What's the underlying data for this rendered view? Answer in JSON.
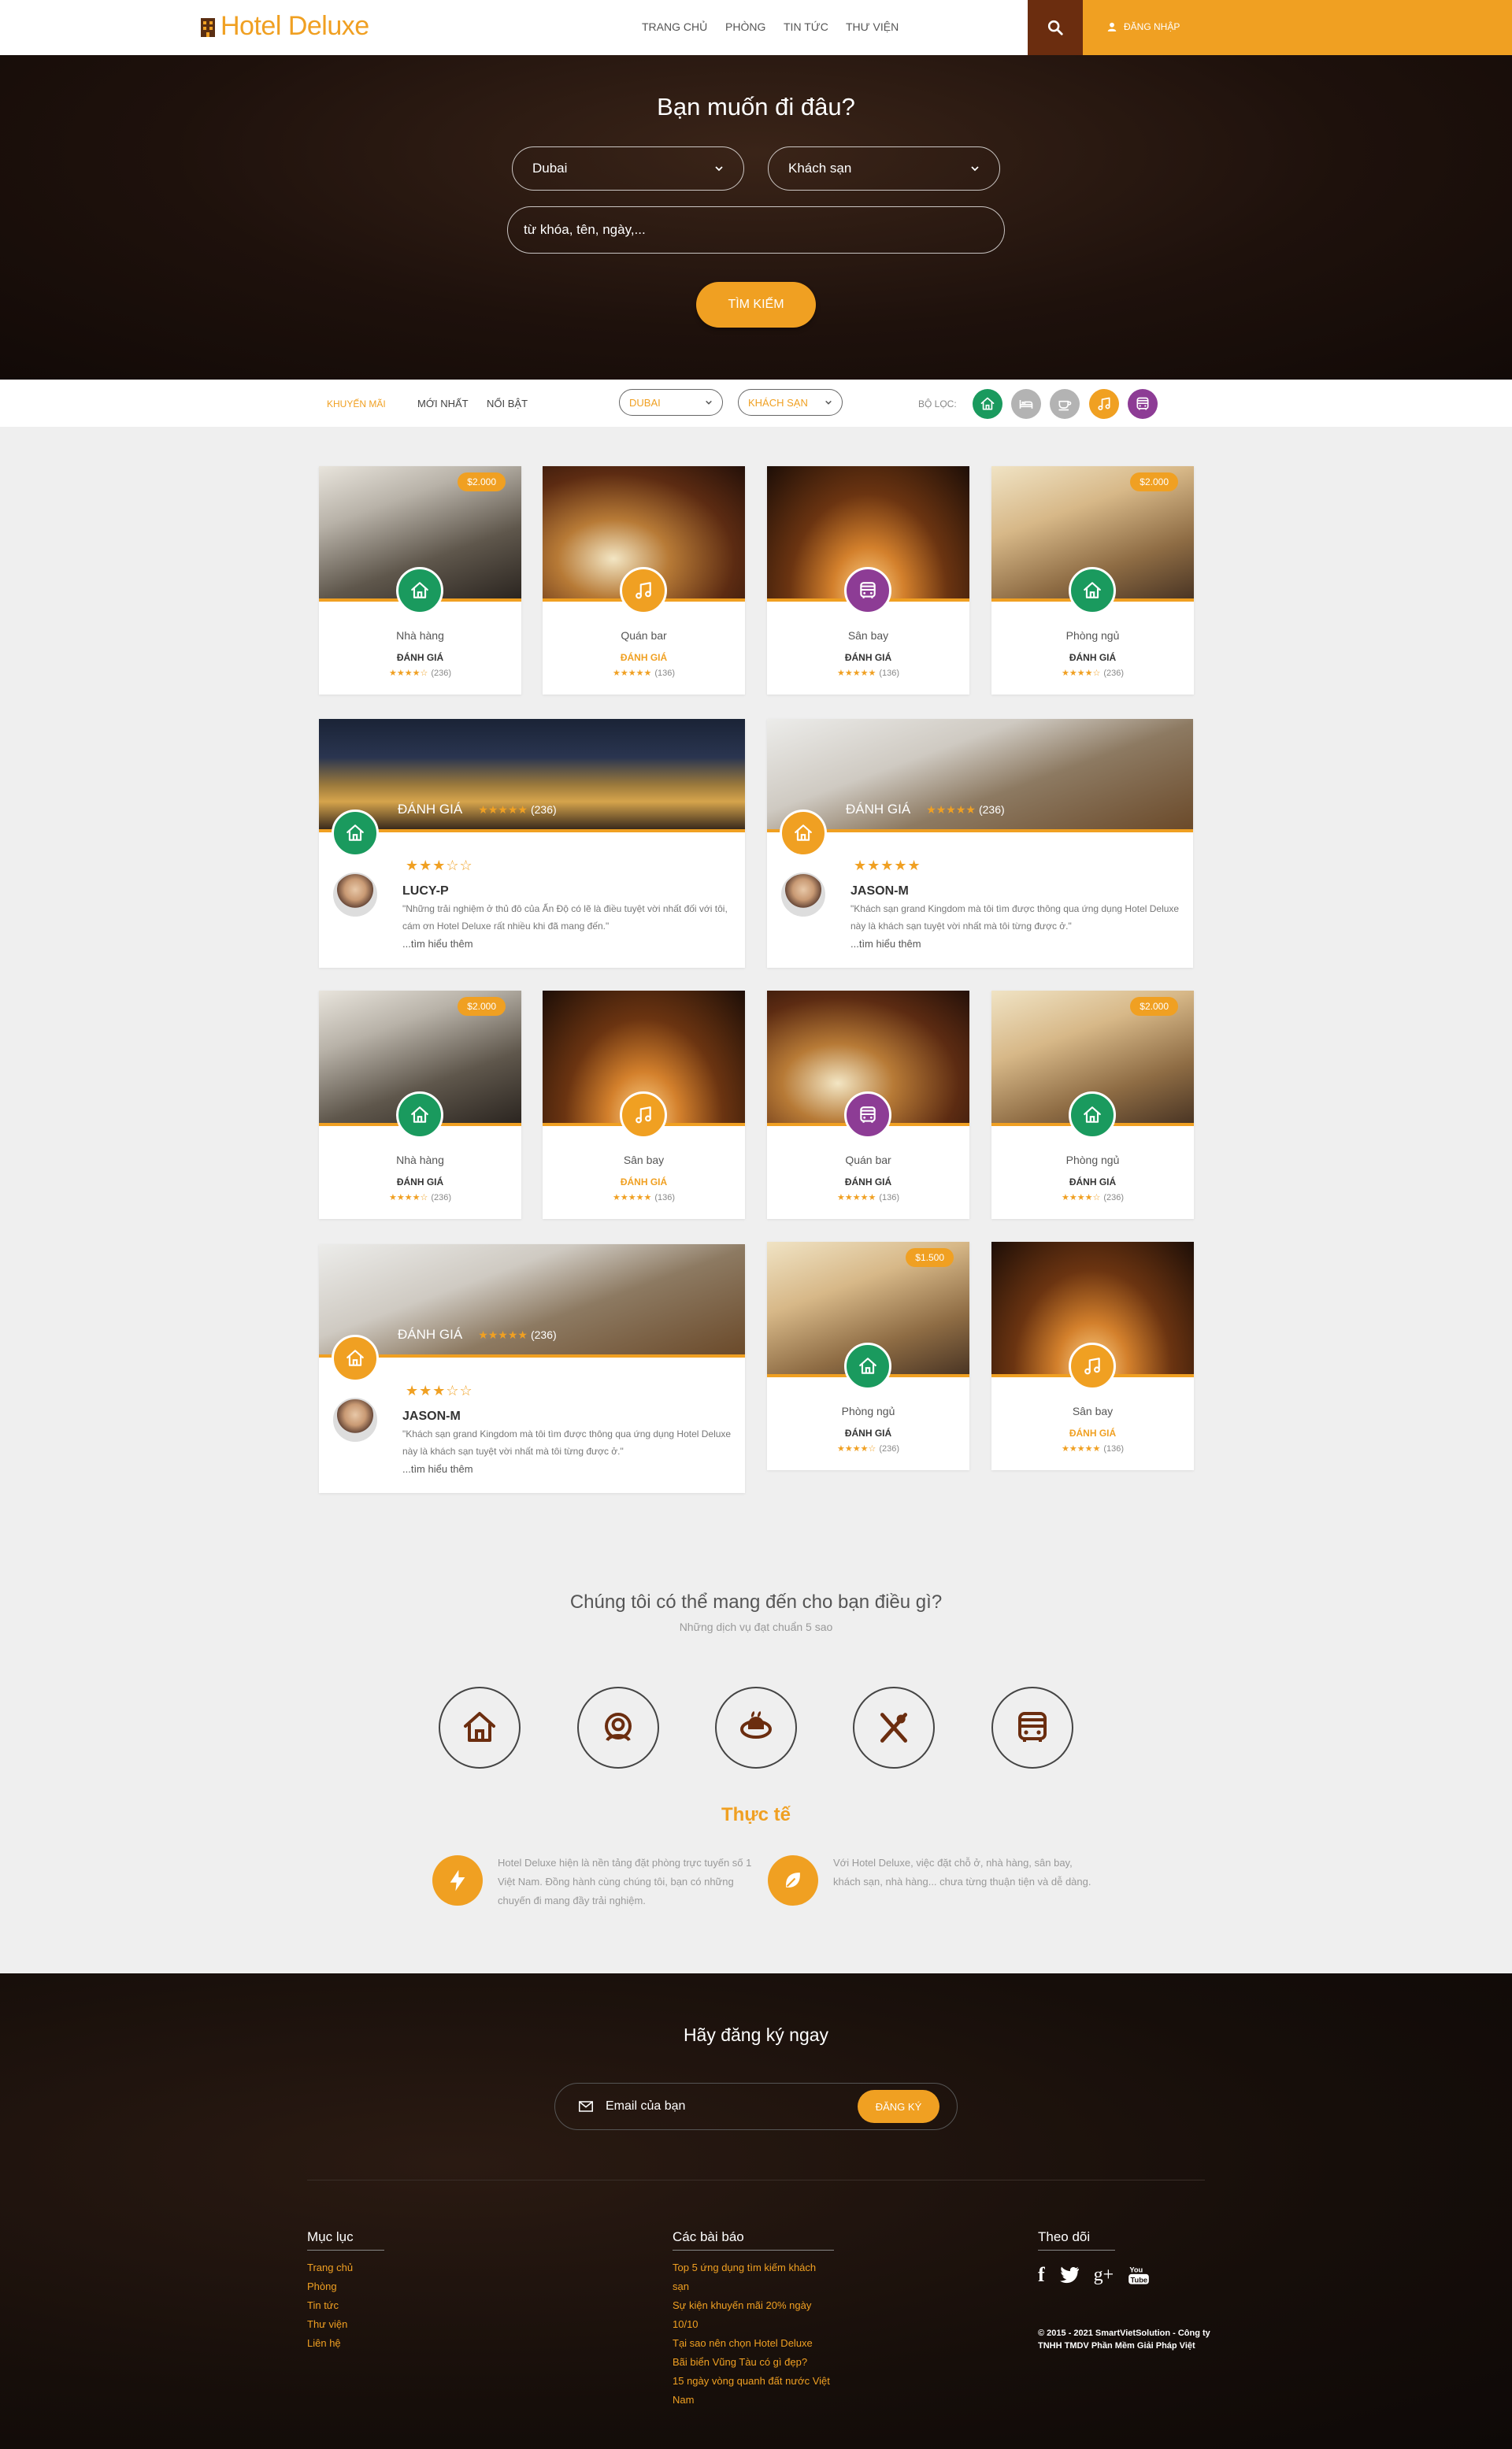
{
  "header": {
    "brand": "Hotel Deluxe",
    "nav": [
      "TRANG CHỦ",
      "PHÒNG",
      "TIN TỨC",
      "THƯ VIỆN"
    ],
    "login_label": "Đăng nhập"
  },
  "hero": {
    "title": "Bạn muốn đi đâu?",
    "location_select": "Dubai",
    "type_select": "Khách sạn",
    "keyword_placeholder": "từ khóa, tên, ngày,...",
    "search_button": "TÌM KIẾM"
  },
  "filter_bar": {
    "tabs": [
      "KHUYẾN MÃI",
      "MỚI NHẤT",
      "NỔI BẬT"
    ],
    "location_select": "DUBAI",
    "type_select": "KHÁCH SẠN",
    "filter_label": "BỘ LỌC:"
  },
  "rating_label": "ĐÁNH GIÁ",
  "cards": [
    {
      "name": "Nhà hàng",
      "price": "$2.000",
      "icon": "home-icon",
      "count": "(236)",
      "rating": 3.5
    },
    {
      "name": "Quán bar",
      "icon": "music-icon",
      "count": "(136)",
      "rating": 5
    },
    {
      "name": "Sân bay",
      "icon": "bus-icon",
      "count": "(136)",
      "rating": 5
    },
    {
      "name": "Phòng ngủ",
      "price": "$2.000",
      "icon": "home-icon",
      "count": "(236)",
      "rating": 4
    },
    {
      "name": "Nhà hàng",
      "price": "$2.000",
      "icon": "home-icon",
      "count": "(236)",
      "rating": 4
    },
    {
      "name": "Sân bay",
      "icon": "music-icon",
      "count": "(136)",
      "rating": 5
    },
    {
      "name": "Quán bar",
      "icon": "bus-icon",
      "count": "(136)",
      "rating": 5
    },
    {
      "name": "Phòng ngủ",
      "price": "$2.000",
      "icon": "home-icon",
      "count": "(236)",
      "rating": 4
    },
    {
      "name": "Phòng ngủ",
      "price": "$1.500",
      "icon": "home-icon",
      "count": "(236)",
      "rating": 3.5
    },
    {
      "name": "Sân bay",
      "icon": "music-icon",
      "count": "(136)",
      "rating": 5
    }
  ],
  "reviews": [
    {
      "user": "LUCY-P",
      "count": "(236)",
      "rating": 3,
      "text": "\"Những trải nghiệm ở thủ đô của Ấn Độ có lẽ là điều tuyệt vời nhất đối với tôi, cám ơn Hotel Deluxe rất nhiều khi đã mang đến.\"",
      "more": "...tìm hiểu thêm"
    },
    {
      "user": "JASON-M",
      "count": "(236)",
      "rating": 5,
      "text": "\"Khách sạn grand Kingdom mà tôi tìm được thông qua ứng dụng Hotel Deluxe này là khách sạn tuyệt vời nhất mà tôi từng được ở.\"",
      "more": "...tìm hiểu thêm"
    },
    {
      "user": "JASON-M",
      "count": "(236)",
      "rating": 3,
      "text": "\"Khách sạn grand Kingdom mà tôi tìm được thông qua ứng dụng Hotel Deluxe này là khách sạn tuyệt vời nhất mà tôi từng được ở.\"",
      "more": "...tìm hiểu thêm"
    }
  ],
  "services": {
    "title": "Chúng tôi có thể mang đến cho bạn điều gì?",
    "subtitle": "Những dịch vụ đạt chuẩn 5 sao",
    "icons": [
      "home-icon",
      "receptionist-icon",
      "coffee-icon",
      "restaurant-icon",
      "bus-icon"
    ],
    "fact_title": "Thực tế",
    "facts": [
      {
        "icon": "lightning-icon",
        "text": "Hotel Deluxe hiện là nền tảng đặt phòng trực tuyến số 1 Việt Nam. Đồng hành cùng chúng tôi, bạn có những chuyến đi mang đầy trải nghiệm."
      },
      {
        "icon": "leaf-icon",
        "text": "Với Hotel Deluxe, việc đặt chỗ ở, nhà hàng, sân bay, khách sạn, nhà hàng... chưa từng thuận tiện và dễ dàng."
      }
    ]
  },
  "footer": {
    "signup_title": "Hãy đăng ký ngay",
    "email_placeholder": "Email của bạn",
    "signup_button": "ĐĂNG KÝ",
    "menu_title": "Mục lục",
    "menu": [
      "Trang chủ",
      "Phòng",
      "Tin tức",
      "Thư viện",
      "Liên hệ"
    ],
    "posts_title": "Các bài báo",
    "posts": [
      "Top 5 ứng dụng tìm kiếm khách sạn",
      "Sự kiện khuyến mãi 20% ngày 10/10",
      "Tại sao nên chọn Hotel Deluxe",
      "Bãi biển Vũng Tàu có gì đẹp?",
      "15 ngày vòng quanh đất nước Việt Nam"
    ],
    "follow_title": "Theo dõi",
    "social": [
      "facebook-icon",
      "twitter-icon",
      "googleplus-icon",
      "youtube-icon"
    ],
    "copyright": "© 2015 - 2021 SmartVietSolution - Công ty TNHH TMDV Phần Mềm Giải Pháp Việt"
  },
  "colors": {
    "accent": "#f0a022",
    "green": "#1a9a5e",
    "purple": "#8d3c95",
    "dark_brown": "#6b2d0f",
    "gray_icon": "#b3b3b3"
  }
}
